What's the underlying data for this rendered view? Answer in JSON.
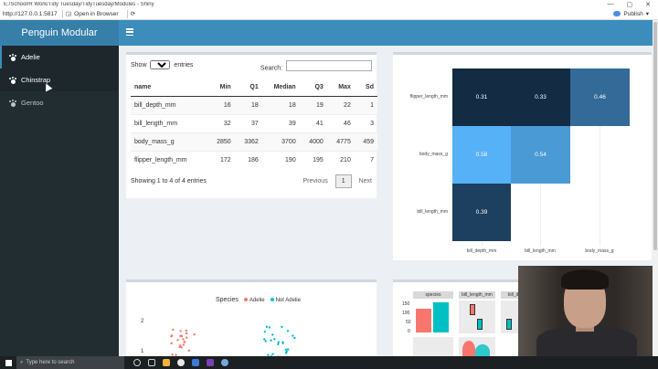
{
  "window": {
    "title": "E:/School/R Work/Tidy Tuesday/TidyTuesday/Modules - Shiny",
    "address": "http://127.0.0.1:5817",
    "open_in_browser": "Open in Browser",
    "publish": "Publish"
  },
  "app": {
    "brand": "Penguin Modular",
    "sidebar": [
      {
        "label": "Adelie"
      },
      {
        "label": "Chinstrap"
      },
      {
        "label": "Gentoo"
      }
    ]
  },
  "table": {
    "show_label": "Show",
    "entries_value": "10",
    "entries_label": "entries",
    "search_label": "Search:",
    "search_value": "",
    "columns": [
      "name",
      "Min",
      "Q1",
      "Median",
      "Q3",
      "Max",
      "Sd"
    ],
    "rows": [
      [
        "bill_depth_mm",
        "16",
        "18",
        "18",
        "19",
        "22",
        "1"
      ],
      [
        "bill_length_mm",
        "32",
        "37",
        "39",
        "41",
        "46",
        "3"
      ],
      [
        "body_mass_g",
        "2850",
        "3362",
        "3700",
        "4000",
        "4775",
        "459"
      ],
      [
        "flipper_length_mm",
        "172",
        "186",
        "190",
        "195",
        "210",
        "7"
      ]
    ],
    "info": "Showing 1 to 4 of 4 entries",
    "previous": "Previous",
    "page": "1",
    "next": "Next"
  },
  "heatmap": {
    "ylabels": [
      "flipper_length_mm",
      "body_mass_g",
      "bill_length_mm"
    ],
    "xlabels": [
      "bill_depth_mm",
      "bill_length_mm",
      "body_mass_g"
    ],
    "cells": [
      {
        "label": "0.31",
        "color": "#132b43"
      },
      {
        "label": "0.33",
        "color": "#132b43"
      },
      {
        "label": "0.46",
        "color": "#336a98"
      },
      {
        "label": "0.58",
        "color": "#56b1f7"
      },
      {
        "label": "0.54",
        "color": "#4a9ad5"
      },
      {
        "label": "0.39",
        "color": "#1d3f60"
      }
    ]
  },
  "scatter": {
    "legend_title": "Species",
    "legend_items": [
      {
        "label": "Adelie",
        "color": "#f8766d"
      },
      {
        "label": "Not Adelie",
        "color": "#00bfc4"
      }
    ],
    "yticks": [
      "2",
      "1"
    ]
  },
  "pairs": {
    "strips": [
      "species",
      "bill_length_mm",
      "bill_de"
    ],
    "yticks": [
      "150",
      "100",
      "50",
      "0"
    ]
  },
  "taskbar": {
    "search_placeholder": "Type here to search"
  }
}
